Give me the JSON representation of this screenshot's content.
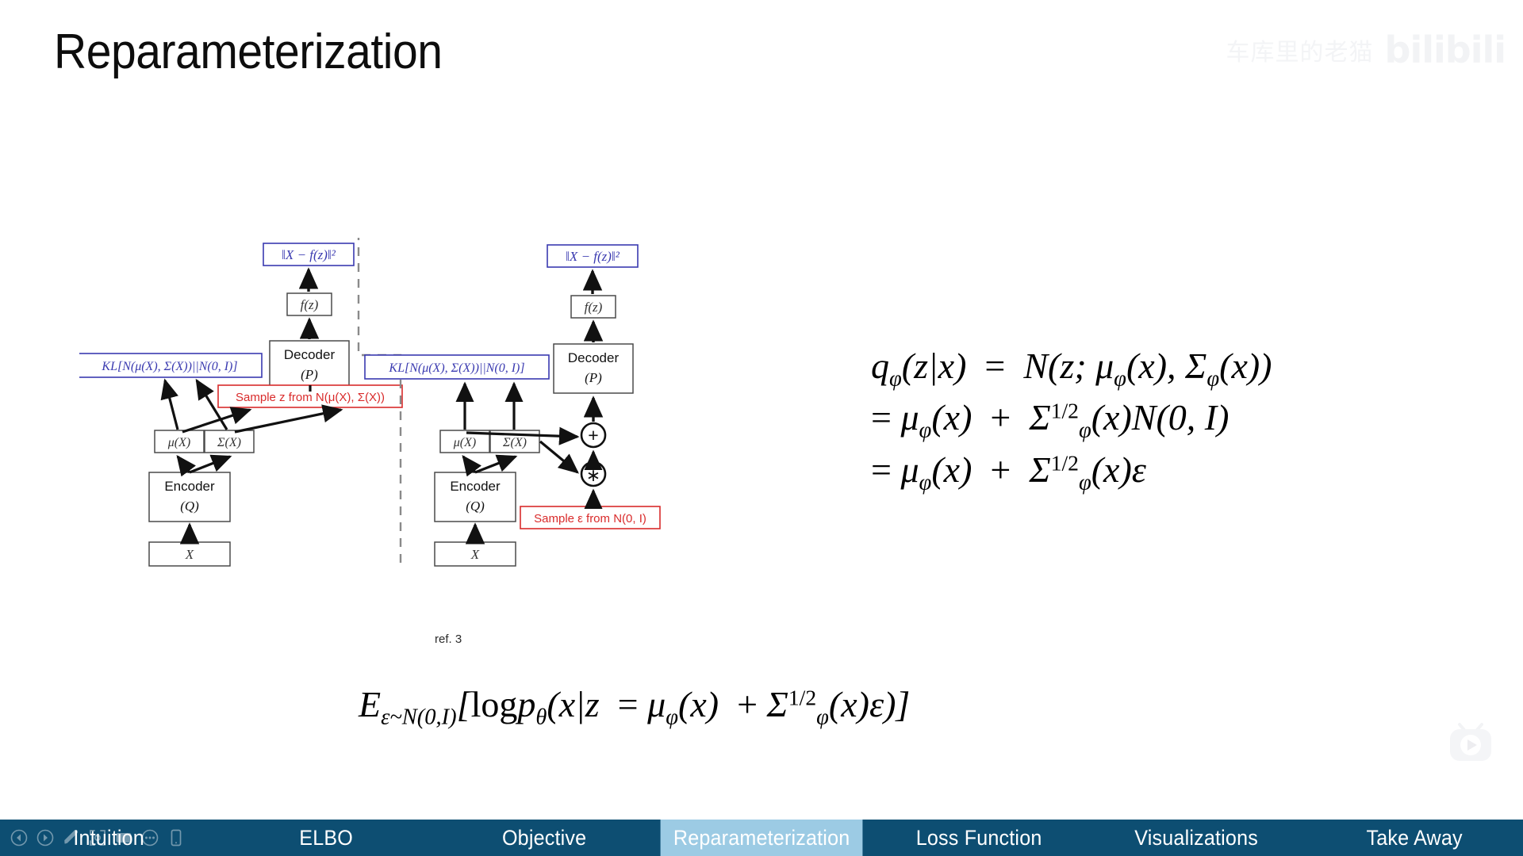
{
  "slide": {
    "title": "Reparameterization",
    "figure_caption": "ref. 3"
  },
  "watermark": {
    "username": "车库里的老猫",
    "logo": "bilibili",
    "play_icon": "bilibili-tv-play-icon"
  },
  "diagram": {
    "left_panel": {
      "recon_loss": "‖X − f(z)‖²",
      "fz": "f(z)",
      "decoder_line1": "Decoder",
      "decoder_line2": "(P)",
      "kl": "KL[N(μ(X), Σ(X))||N(0, I)]",
      "sample_note": "Sample z from N(μ(X), Σ(X))",
      "mu": "μ(X)",
      "sigma": "Σ(X)",
      "encoder_line1": "Encoder",
      "encoder_line2": "(Q)",
      "input": "X"
    },
    "right_panel": {
      "recon_loss": "‖X − f(z)‖²",
      "fz": "f(z)",
      "decoder_line1": "Decoder",
      "decoder_line2": "(P)",
      "kl": "KL[N(μ(X), Σ(X))||N(0, I)]",
      "sample_note": "Sample ε from N(0, I)",
      "mu": "μ(X)",
      "sigma": "Σ(X)",
      "encoder_line1": "Encoder",
      "encoder_line2": "(Q)",
      "input": "X",
      "plus_operator": "+",
      "times_operator": "∗"
    },
    "colors": {
      "blue_box": "#3a3ab0",
      "red_box": "#d92b2b",
      "black_box": "#3c3c3c",
      "dashed_divider": "#8a8a8a"
    }
  },
  "equations": {
    "line1": "q_φ(z|x) = N(z; μ_φ(x), Σ_φ(x))",
    "line2": "= μ_φ(x) + Σ_φ^{1/2}(x) N(0, I)",
    "line3": "= μ_φ(x) + Σ_φ^{1/2}(x) ε",
    "bottom": "E_{ε~N(0,I)}[log p_θ(x|z = μ_φ(x) + Σ_φ^{1/2}(x)ε)]"
  },
  "navbar": {
    "active_index": 3,
    "accent_active_bg": "#9ccbe4",
    "bar_bg": "#0d4e72",
    "items": [
      {
        "label": "Intuition"
      },
      {
        "label": "ELBO"
      },
      {
        "label": "Objective"
      },
      {
        "label": "Reparameterization"
      },
      {
        "label": "Loss Function"
      },
      {
        "label": "Visualizations"
      },
      {
        "label": "Take Away"
      }
    ],
    "controls": [
      {
        "name": "prev-slide-icon"
      },
      {
        "name": "next-slide-icon"
      },
      {
        "name": "pen-annotate-icon"
      },
      {
        "name": "zoom-region-icon"
      },
      {
        "name": "screen-icon"
      },
      {
        "name": "more-options-icon"
      },
      {
        "name": "mobile-view-icon"
      }
    ]
  }
}
